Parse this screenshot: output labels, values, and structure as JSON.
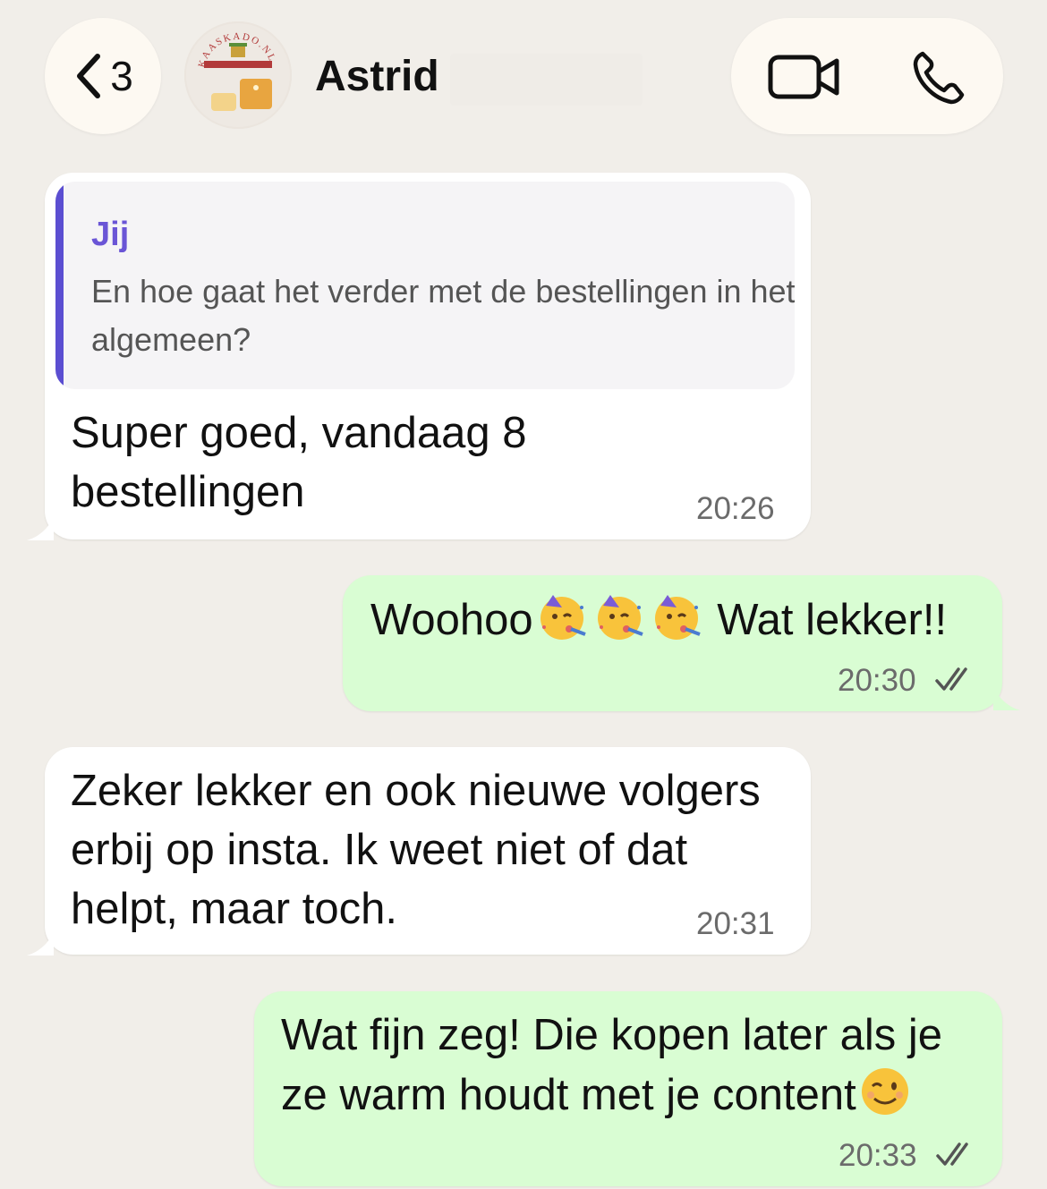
{
  "header": {
    "back_count": "3",
    "contact_name": "Astrid",
    "avatar_icon": "kaaskado-logo-avatar",
    "avatar_logo_text": "KAASKADO.NL"
  },
  "messages": [
    {
      "direction": "incoming",
      "quote_author": "Jij",
      "quote_text": "En hoe gaat het verder met de bestellingen in het algemeen?",
      "line1": "Super goed, vandaag 8",
      "line2": "bestellingen",
      "time": "20:26"
    },
    {
      "direction": "outgoing",
      "text_before": "Woohoo",
      "emoji": "partying-face-emoji",
      "text_after": " Wat lekker!!",
      "time": "20:30",
      "status": "double-check-read"
    },
    {
      "direction": "incoming",
      "line1": "Zeker lekker en ook nieuwe volgers",
      "line2": "erbij op insta. Ik weet niet of dat",
      "line3": "helpt, maar toch.",
      "time": "20:31"
    },
    {
      "direction": "outgoing",
      "line1": "Wat fijn zeg! Die kopen later als je",
      "line2": "ze warm houdt met je content",
      "emoji": "winking-face-emoji",
      "time": "20:33",
      "status": "double-check-read"
    }
  ],
  "colors": {
    "background": "#f1eee9",
    "incoming_bubble": "#ffffff",
    "outgoing_bubble": "#d9fdd3",
    "quote_accent": "#5b4ed1"
  }
}
